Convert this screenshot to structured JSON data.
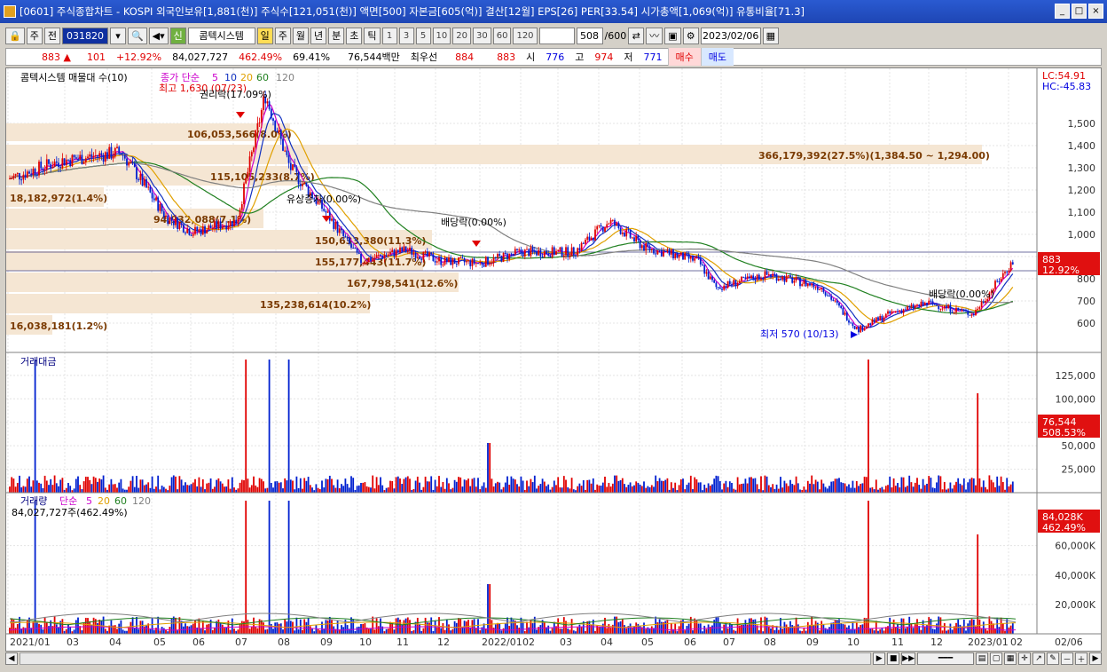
{
  "window": {
    "title": "[0601] 주식종합차트 - KOSPI 외국인보유[1,881(천)] 주식수[121,051(천)] 액면[500] 자본금[605(억)] 결산[12월] EPS[26] PER[33.54] 시가총액[1,069(억)] 유통비율[71.3]",
    "buttons": [
      "_",
      "□",
      "×"
    ]
  },
  "toolbar": {
    "period_unit": "주",
    "market": "전",
    "code": "031820",
    "name": "콤텍시스템",
    "periods": [
      "일",
      "주",
      "월",
      "년",
      "분",
      "초",
      "틱"
    ],
    "active_period": "일",
    "intervals": [
      "1",
      "3",
      "5",
      "10",
      "20",
      "30",
      "60",
      "120"
    ],
    "count": "508",
    "count_max": "/600",
    "date": "2023/02/06"
  },
  "quote": {
    "price": "883",
    "change": "101",
    "change_pct": "+12.92%",
    "volume": "84,027,727",
    "volume_pct": "462.49%",
    "volume_ratio": "69.41%",
    "amount": "76,544백만",
    "best_ask_label": "최우선",
    "best_ask": "884",
    "best_bid": "883",
    "open_label": "시",
    "open": "776",
    "high_label": "고",
    "high": "974",
    "low_label": "저",
    "low": "771",
    "buy_label": "매수",
    "sell_label": "매도"
  },
  "price_panel": {
    "title": "콤텍시스템 매물대 수(10)",
    "ma_label": "종가 단순",
    "ma_periods": [
      "5",
      "10",
      "20",
      "60",
      "120"
    ],
    "ma_colors": [
      "#cc00cc",
      "#1030c0",
      "#e0a000",
      "#208020",
      "#808080"
    ],
    "lc": "LC:54.91",
    "hc": "HC:-45.83",
    "current_price": "883",
    "current_pct": "12.92%",
    "high_annotation": "최고 1,630 (07/23)",
    "low_annotation": "최저 570 (10/13)",
    "events": [
      "권리락(17.09%)",
      "유상증자(0.00%)",
      "배당락(0.00%)",
      "배당락(0.00%)"
    ],
    "volume_profile": [
      "106,053,566(8.0%)",
      "366,179,392(27.5%)(1,384.50 ~ 1,294.00)",
      "115,105,233(8.7%)",
      "18,182,972(1.4%)",
      "94,932,088(7.1%)",
      "150,633,380(11.3%)",
      "155,177,443(11.7%)",
      "167,798,541(12.6%)",
      "135,238,614(10.2%)",
      "16,038,181(1.2%)"
    ]
  },
  "amount_panel": {
    "title": "거래대금",
    "current": "76,544",
    "current_pct": "508.53%"
  },
  "volume_panel": {
    "title": "거래량",
    "ma_label": "단순",
    "ma_periods": [
      "5",
      "20",
      "60",
      "120"
    ],
    "summary": "84,027,727주(462.49%)",
    "current": "84,028K",
    "current_pct": "462.49%"
  },
  "x_axis": [
    "2021/01",
    "03",
    "04",
    "05",
    "06",
    "07",
    "08",
    "09",
    "10",
    "11",
    "12",
    "2022/01",
    "02",
    "03",
    "04",
    "05",
    "06",
    "07",
    "08",
    "09",
    "10",
    "11",
    "12",
    "2023/01",
    "02",
    "02/06"
  ],
  "chart_data": [
    {
      "type": "line",
      "title": "콤텍시스템",
      "x": [
        "2021/01",
        "03",
        "04",
        "05",
        "06",
        "07",
        "07/23",
        "08",
        "09",
        "10",
        "11",
        "12",
        "2022/01",
        "02",
        "03",
        "04",
        "05",
        "06",
        "07",
        "08",
        "09",
        "10/13",
        "11",
        "12",
        "2023/01",
        "02/06"
      ],
      "series": [
        {
          "name": "종가",
          "values": [
            1250,
            1330,
            1370,
            1080,
            1010,
            1060,
            1630,
            1300,
            1100,
            880,
            930,
            880,
            870,
            920,
            920,
            1060,
            940,
            880,
            760,
            820,
            760,
            570,
            650,
            690,
            640,
            883
          ]
        }
      ],
      "yticks": [
        600,
        700,
        800,
        900,
        1000,
        1100,
        1200,
        1300,
        1400,
        1500
      ],
      "ylim": [
        540,
        1660
      ]
    },
    {
      "type": "bar",
      "title": "거래대금",
      "yticks": [
        25000,
        50000,
        75000,
        100000,
        125000
      ]
    },
    {
      "type": "bar",
      "title": "거래량",
      "yticks": [
        "20,000K",
        "40,000K",
        "60,000K"
      ]
    }
  ],
  "y_price_ticks": [
    "1,500",
    "1,400",
    "1,300",
    "1,200",
    "1,100",
    "1,000",
    "900",
    "800",
    "700",
    "600"
  ],
  "y_amount_ticks": [
    "125,000",
    "100,000",
    "75,000",
    "50,000",
    "25,000"
  ],
  "y_volume_ticks": [
    "60,000K",
    "40,000K",
    "20,000K"
  ]
}
